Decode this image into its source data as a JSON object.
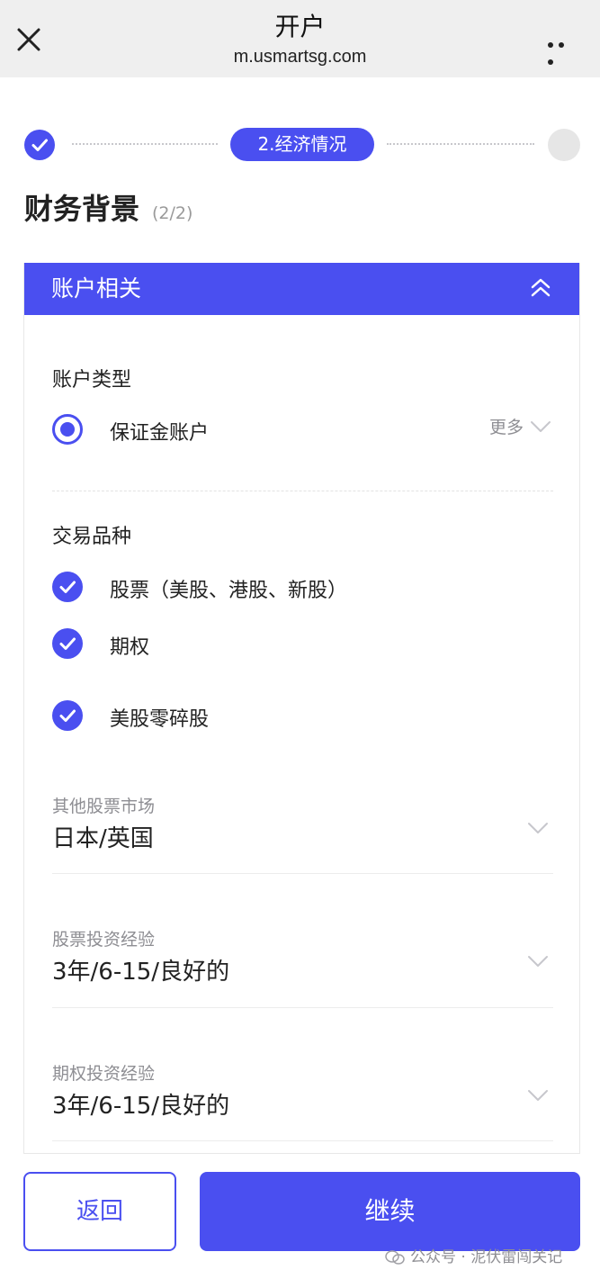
{
  "header": {
    "title": "开户",
    "url": "m.usmartsg.com"
  },
  "stepper": {
    "current_label": "2.经济情况"
  },
  "heading": {
    "title": "财务背景",
    "progress": "(2/2)"
  },
  "section": {
    "title": "账户相关",
    "account_type": {
      "label": "账户类型",
      "selected": "保证金账户",
      "more_label": "更多"
    },
    "trade_products": {
      "label": "交易品种",
      "items": [
        {
          "label": "股票（美股、港股、新股）",
          "checked": true
        },
        {
          "label": "期权",
          "checked": true
        },
        {
          "label": "美股零碎股",
          "checked": true
        }
      ]
    },
    "fields": [
      {
        "label": "其他股票市场",
        "value": "日本/英国"
      },
      {
        "label": "股票投资经验",
        "value": "3年/6-15/良好的"
      },
      {
        "label": "期权投资经验",
        "value": "3年/6-15/良好的"
      }
    ]
  },
  "footer": {
    "back_label": "返回",
    "continue_label": "继续"
  },
  "watermark": "公众号 · 泥伏雷闯关记",
  "colors": {
    "accent": "#4a4ff0",
    "topbar_bg": "#efefef"
  }
}
